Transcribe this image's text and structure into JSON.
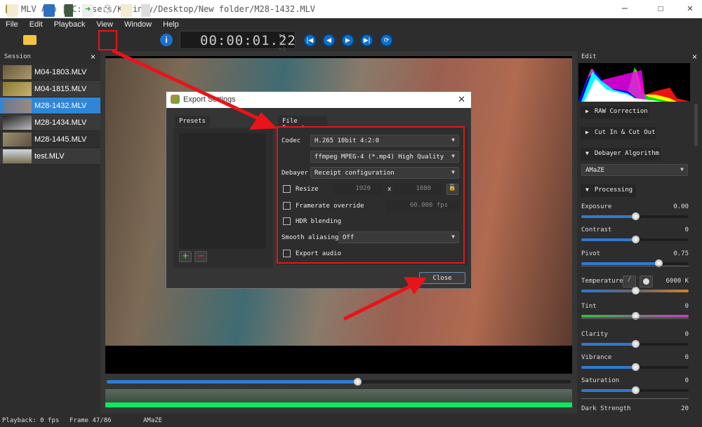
{
  "window": {
    "title": "MLV App | C:/Users/Kevincy/Desktop/New folder/M28-1432.MLV",
    "minimize": "—",
    "maximize": "☐",
    "close": "✕"
  },
  "menu": [
    "File",
    "Edit",
    "Playback",
    "View",
    "Window",
    "Help"
  ],
  "toolbar": {
    "icons": [
      "new-file-icon",
      "open-folder-icon",
      "save-icon",
      "delete-icon",
      "import-icon",
      "export-settings-gear-icon",
      "copy-icon",
      "paste-icon",
      "info-icon"
    ],
    "timecode": "00:00:01.22",
    "tc_label": "TC",
    "tc_sub": "[<->]",
    "playback": [
      "skip-start",
      "prev-frame",
      "play",
      "next-frame",
      "loop"
    ]
  },
  "session": {
    "title": "Session",
    "close": "×",
    "items": [
      {
        "name": "M04-1803.MLV"
      },
      {
        "name": "M04-1815.MLV"
      },
      {
        "name": "M28-1432.MLV",
        "selected": true
      },
      {
        "name": "M28-1434.MLV"
      },
      {
        "name": "M28-1445.MLV"
      },
      {
        "name": "test.MLV"
      }
    ]
  },
  "playback": {
    "position_fraction": 0.54
  },
  "status": {
    "playback": "Playback: 0 fps",
    "frame": "Frame 47/86",
    "debayer": "AMaZE"
  },
  "edit": {
    "title": "Edit",
    "close": "×",
    "sections": {
      "raw": "RAW Correction",
      "cut": "Cut In & Cut Out",
      "debayer": "Debayer Algorithm",
      "processing": "Processing"
    },
    "debayer_value": "AMaZE",
    "sliders": [
      {
        "label": "Exposure",
        "value": "0.00",
        "fraction": 0.5
      },
      {
        "label": "Contrast",
        "value": "0",
        "fraction": 0.5
      },
      {
        "label": "Pivot",
        "value": "0.75",
        "fraction": 0.72
      },
      {
        "label": "Temperature",
        "value": "6000 K",
        "fraction": 0.5
      },
      {
        "label": "Tint",
        "value": "0",
        "fraction": 0.5
      },
      {
        "label": "Clarity",
        "value": "0",
        "fraction": 0.5
      },
      {
        "label": "Vibrance",
        "value": "0",
        "fraction": 0.5
      },
      {
        "label": "Saturation",
        "value": "0",
        "fraction": 0.5
      },
      {
        "label": "Dark Strength",
        "value": "20"
      }
    ]
  },
  "dialog": {
    "title": "Export Settings",
    "close": "✕",
    "presets_tab": "Presets",
    "file_export_tab": "File Export",
    "codec_label": "Codec",
    "codec": "H.265 10bit 4:2:0",
    "codec_option": "ffmpeg MPEG-4 (*.mp4) High Quality",
    "debayer_label": "Debayer",
    "debayer": "Receipt configuration",
    "resize_label": "Resize",
    "resize_w": "1920",
    "resize_x": "x",
    "resize_h": "1080",
    "framerate_label": "Framerate override",
    "framerate": "60.000 fps",
    "hdr_label": "HDR blending",
    "smooth_label": "Smooth aliasing",
    "smooth": "Off",
    "audio_label": "Export audio",
    "add": "+",
    "remove": "−",
    "close_button": "Close"
  },
  "colors": {
    "accent": "#2f86d8",
    "annotation": "#e8141a",
    "waveform": "#12e760"
  }
}
